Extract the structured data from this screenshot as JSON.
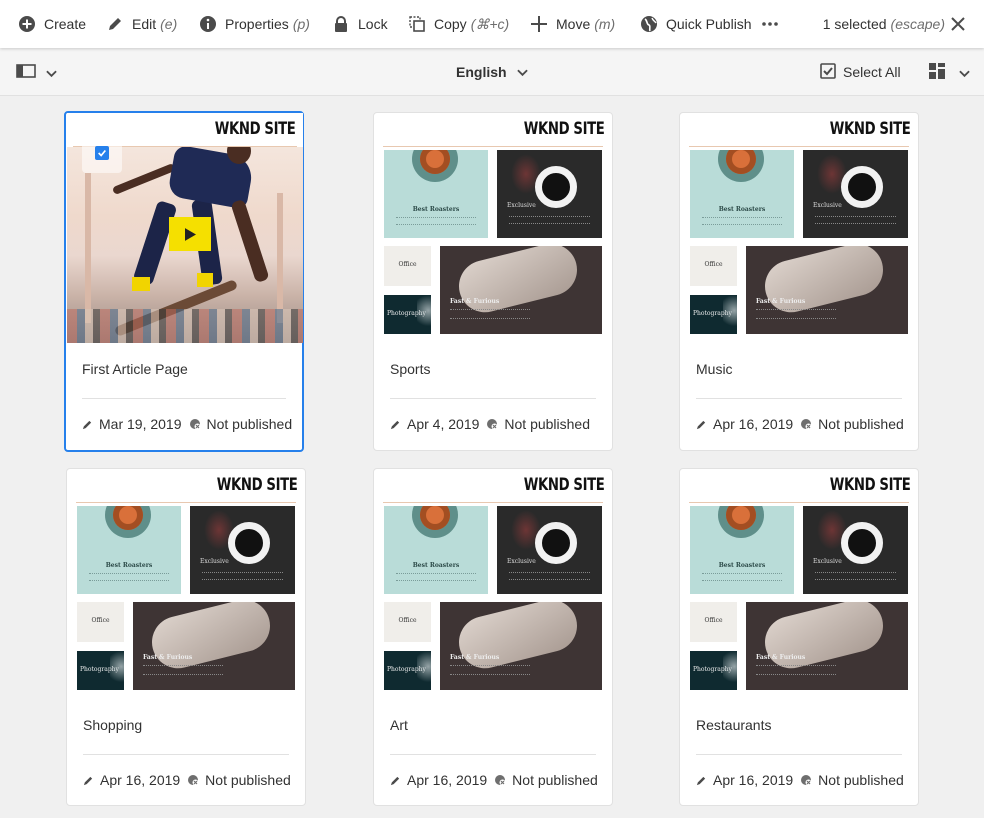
{
  "actionbar": {
    "actions": [
      {
        "label": "Create",
        "shortcut": "",
        "icon": "add-circle-icon"
      },
      {
        "label": "Edit",
        "shortcut": "(e)",
        "icon": "pencil-icon"
      },
      {
        "label": "Properties",
        "shortcut": "(p)",
        "icon": "info-icon"
      },
      {
        "label": "Lock",
        "shortcut": "",
        "icon": "lock-icon"
      },
      {
        "label": "Copy",
        "shortcut": "(⌘+c)",
        "icon": "copy-icon"
      },
      {
        "label": "Move",
        "shortcut": "(m)",
        "icon": "move-icon"
      },
      {
        "label": "Quick Publish",
        "shortcut": "",
        "icon": "globe-icon"
      }
    ],
    "more_icon": "more-icon",
    "selection": {
      "text": "1 selected",
      "hint": "(escape)"
    },
    "close_icon": "close-icon"
  },
  "toolbar": {
    "rail_icon": "rail-toggle-icon",
    "language": "English",
    "select_all": "Select All",
    "view_icon": "card-view-icon"
  },
  "cards": [
    {
      "title": "First Article Page",
      "date": "Mar 19, 2019",
      "status": "Not published",
      "selected": true,
      "thumbnail": "skater-video"
    },
    {
      "title": "Sports",
      "date": "Apr 4, 2019",
      "status": "Not published",
      "selected": false,
      "thumbnail": "wknd-site"
    },
    {
      "title": "Music",
      "date": "Apr 16, 2019",
      "status": "Not published",
      "selected": false,
      "thumbnail": "wknd-site"
    },
    {
      "title": "Shopping",
      "date": "Apr 16, 2019",
      "status": "Not published",
      "selected": false,
      "thumbnail": "wknd-site"
    },
    {
      "title": "Art",
      "date": "Apr 16, 2019",
      "status": "Not published",
      "selected": false,
      "thumbnail": "wknd-site"
    },
    {
      "title": "Restaurants",
      "date": "Apr 16, 2019",
      "status": "Not published",
      "selected": false,
      "thumbnail": "wknd-site"
    }
  ],
  "thumbnail_text": {
    "brand": "WKND SITE",
    "tile1": "Best Roasters",
    "tile2": "Exclusive",
    "tile3": "Office",
    "tile4": "Photography",
    "tile5": "Fast & Furious"
  },
  "colors": {
    "accent": "#2680eb",
    "play": "#f5e000"
  }
}
